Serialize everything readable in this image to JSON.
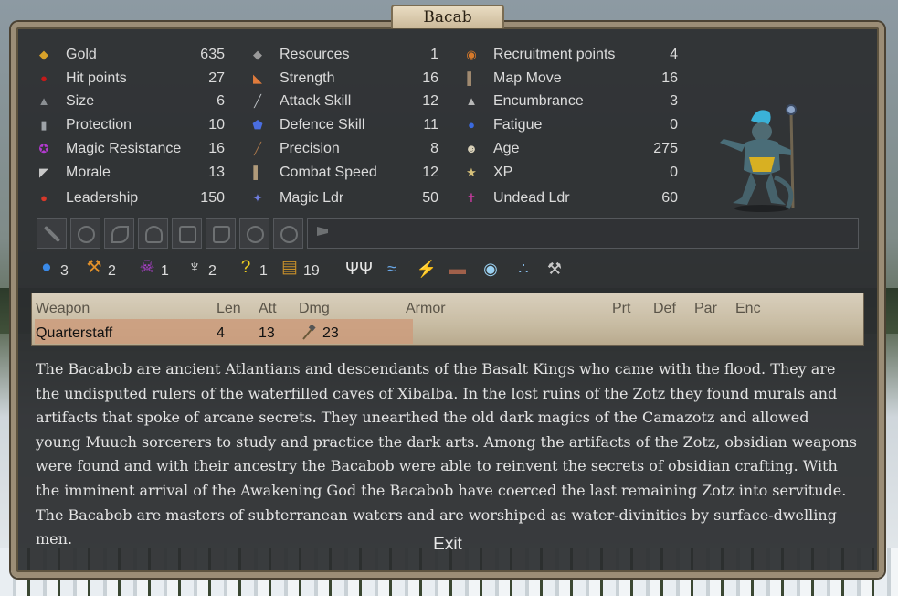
{
  "window": {
    "title": "Bacab"
  },
  "stats": {
    "col1": [
      {
        "label": "Gold",
        "value": "635",
        "icon": "gold-icon",
        "color": "#d8a22a"
      },
      {
        "label": "Hit points",
        "value": "27",
        "icon": "heart-drop-icon",
        "color": "#c41a1a"
      },
      {
        "label": "Size",
        "value": "6",
        "icon": "elephant-icon",
        "color": "#8b8f93"
      },
      {
        "label": "Protection",
        "value": "10",
        "icon": "armor-icon",
        "color": "#9ea3a8"
      },
      {
        "label": "Magic Resistance",
        "value": "16",
        "icon": "pentagram-icon",
        "color": "#b43ad1"
      },
      {
        "label": "Morale",
        "value": "13",
        "icon": "banner-icon",
        "color": "#c9c9c9"
      },
      {
        "label": "Leadership",
        "value": "150",
        "icon": "helmet-icon",
        "color": "#d8382a"
      }
    ],
    "col2": [
      {
        "label": "Resources",
        "value": "1",
        "icon": "anvil-icon",
        "color": "#9a9a9a"
      },
      {
        "label": "Strength",
        "value": "16",
        "icon": "arm-icon",
        "color": "#e07b3c"
      },
      {
        "label": "Attack Skill",
        "value": "12",
        "icon": "sword-icon",
        "color": "#b8bcc0"
      },
      {
        "label": "Defence Skill",
        "value": "11",
        "icon": "shield-icon",
        "color": "#4a6ee0"
      },
      {
        "label": "Precision",
        "value": "8",
        "icon": "bow-icon",
        "color": "#a4744a"
      },
      {
        "label": "Combat Speed",
        "value": "12",
        "icon": "boots-icon",
        "color": "#b09a7a"
      },
      {
        "label": "Magic Ldr",
        "value": "50",
        "icon": "mage-icon",
        "color": "#6f7de0"
      }
    ],
    "col3": [
      {
        "label": "Recruitment points",
        "value": "4",
        "icon": "recruit-icon",
        "color": "#d87a2a"
      },
      {
        "label": "Map Move",
        "value": "16",
        "icon": "boot-icon",
        "color": "#a08a70"
      },
      {
        "label": "Encumbrance",
        "value": "3",
        "icon": "weight-icon",
        "color": "#b8b8b8"
      },
      {
        "label": "Fatigue",
        "value": "0",
        "icon": "sweat-drop-icon",
        "color": "#3a6ae0"
      },
      {
        "label": "Age",
        "value": "275",
        "icon": "skull-icon",
        "color": "#d8d0b8"
      },
      {
        "label": "XP",
        "value": "0",
        "icon": "star-icon",
        "color": "#d8c27a"
      },
      {
        "label": "Undead Ldr",
        "value": "60",
        "icon": "undead-icon",
        "color": "#c03a9a"
      }
    ]
  },
  "magic_paths": [
    {
      "value": "3",
      "icon": "water-path-icon",
      "color": "#3a8ae8"
    },
    {
      "value": "2",
      "icon": "earth-path-icon",
      "color": "#e0902a"
    },
    {
      "value": "1",
      "icon": "death-path-icon",
      "color": "#b040d0"
    },
    {
      "value": "2",
      "icon": "astral-path-icon",
      "color": "#e8e8e8"
    },
    {
      "value": "1",
      "icon": "random-path-icon",
      "color": "#f0d020"
    },
    {
      "value": "19",
      "icon": "research-icon",
      "color": "#c8902a"
    }
  ],
  "abilities": [
    "holy-candelabra-icon",
    "shrimp-icon",
    "ice-shards-icon",
    "boar-icon",
    "eye-icon",
    "bubbles-icon",
    "forge-hammer-icon"
  ],
  "weapons": {
    "headers": {
      "weapon": "Weapon",
      "len": "Len",
      "att": "Att",
      "dmg": "Dmg",
      "armor": "Armor",
      "prt": "Prt",
      "def": "Def",
      "par": "Par",
      "enc": "Enc"
    },
    "rows": [
      {
        "name": "Quarterstaff",
        "len": "4",
        "att": "13",
        "dmg": "23"
      }
    ]
  },
  "description": "The Bacabob are ancient Atlantians and descendants of the Basalt Kings who came with the flood. They are the undisputed rulers of the waterfilled caves of Xibalba. In the lost ruins of the Zotz they found murals and artifacts that spoke of arcane secrets. They unearthed the old dark magics of the Camazotz and allowed young Muuch sorcerers to study and practice the dark arts. Among the artifacts of the Zotz, obsidian weapons were found and with their ancestry the Bacabob were able to reinvent the secrets of obsidian crafting. With the imminent arrival of the Awakening God the Bacabob have coerced the last remaining Zotz into servitude. The Bacabob are masters of subterranean waters and are worshiped as water-divinities by surface-dwelling men.",
  "exit_label": "Exit"
}
